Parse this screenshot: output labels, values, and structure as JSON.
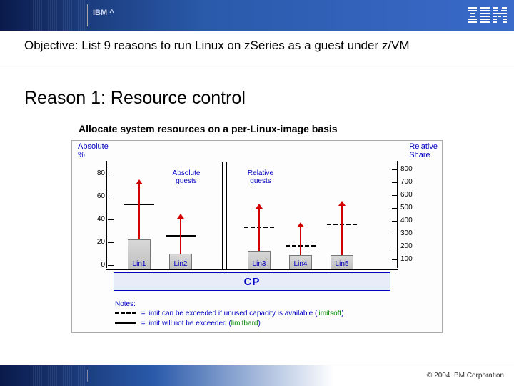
{
  "header": {
    "brand_small": "IBM ^",
    "logo_text": "IBM"
  },
  "objective": "Objective: List 9 reasons to run Linux on zSeries as a guest under z/VM",
  "reason": {
    "title": "Reason 1: Resource control",
    "subtitle": "Allocate system resources on a per-Linux-image basis"
  },
  "chart_data": {
    "type": "bar",
    "left_axis": {
      "title": "Absolute\n%",
      "ticks": [
        0,
        20,
        40,
        60,
        80
      ]
    },
    "right_axis": {
      "title": "Relative\nShare",
      "ticks": [
        100,
        200,
        300,
        400,
        500,
        600,
        700,
        800
      ]
    },
    "groups": [
      {
        "name": "Absolute guests",
        "bars": [
          "Lin1",
          "Lin2"
        ]
      },
      {
        "name": "Relative guests",
        "bars": [
          "Lin3",
          "Lin4",
          "Lin5"
        ]
      }
    ],
    "bars": [
      {
        "label": "Lin1",
        "value_pct": 26,
        "scale": "left",
        "limit_type": "solid",
        "limit_at": 58
      },
      {
        "label": "Lin2",
        "value_pct": 14,
        "scale": "left",
        "limit_type": "solid",
        "limit_at": 30
      },
      {
        "label": "Lin3",
        "value_pct": 16,
        "scale": "right",
        "limit_type": "dash",
        "limit_at": 38
      },
      {
        "label": "Lin4",
        "value_pct": 12,
        "scale": "right",
        "limit_type": "dash",
        "limit_at": 22
      },
      {
        "label": "Lin5",
        "value_pct": 12,
        "scale": "right",
        "limit_type": "dash",
        "limit_at": 40
      }
    ],
    "cp_label": "CP",
    "notes": {
      "heading": "Notes:",
      "line1_pre": "= limit can be exceeded if unused capacity is available (",
      "line1_kw": "limitsoft",
      "line1_post": ")",
      "line2_pre": "= limit will not be exceeded (",
      "line2_kw": "limithard",
      "line2_post": ")"
    }
  },
  "footer": {
    "copyright": "© 2004 IBM Corporation"
  }
}
